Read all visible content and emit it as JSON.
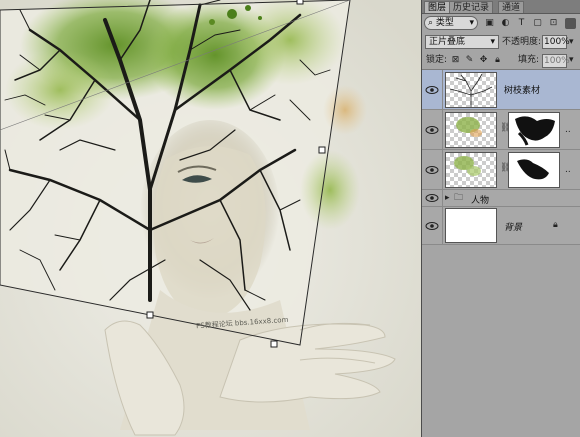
{
  "panel": {
    "tabs": [
      "图层",
      "历史记录",
      "通道"
    ],
    "filter": {
      "label": "类型",
      "icons": [
        "image-filter-icon",
        "adjustment-filter-icon",
        "text-filter-icon",
        "shape-filter-icon",
        "smart-object-filter-icon"
      ]
    },
    "blend_mode": "正片叠底",
    "opacity_label": "不透明度:",
    "opacity_value": "100%",
    "lock_label": "锁定:",
    "fill_label": "填充:",
    "fill_value": "100%",
    "layers": [
      {
        "name": "树枝素材",
        "selected": true,
        "type": "pixel"
      },
      {
        "name": "",
        "selected": false,
        "type": "masked"
      },
      {
        "name": "",
        "selected": false,
        "type": "masked"
      },
      {
        "name": "人物",
        "selected": false,
        "type": "group"
      },
      {
        "name": "背景",
        "selected": false,
        "type": "background",
        "locked": true
      }
    ]
  },
  "canvas": {
    "watermark": "PS教程论坛 bbs.16xx8.com"
  },
  "colors": {
    "panel_bg": "#a5a5a5",
    "selected_layer": "#a9b7d2",
    "canvas_bg": "#e8e8e0",
    "paint_green": "#6e9a2c"
  }
}
